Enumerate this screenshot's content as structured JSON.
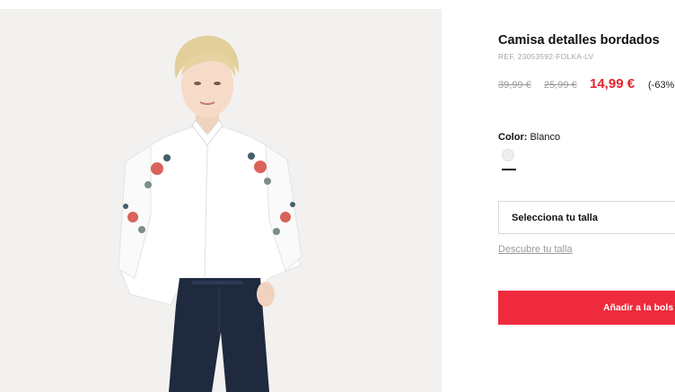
{
  "product": {
    "title": "Camisa detalles bordados",
    "ref": "REF. 23053592-FOLKA-LV",
    "price_original": "39,99 €",
    "price_previous": "25,99 €",
    "price_current": "14,99 €",
    "discount": "(-63%",
    "image_alt": "Camisa detalles bordados"
  },
  "color": {
    "label": "Color:",
    "value": "Blanco",
    "swatches": [
      {
        "name": "Blanco",
        "hex": "#efefef",
        "selected": true
      }
    ]
  },
  "size": {
    "select_label": "Selecciona tu talla",
    "guide_link": "Descubre tu talla"
  },
  "cart": {
    "add_label": "Añadir a la bols"
  },
  "colors": {
    "accent": "#ee2a3c",
    "sale_price": "#e3252f"
  }
}
